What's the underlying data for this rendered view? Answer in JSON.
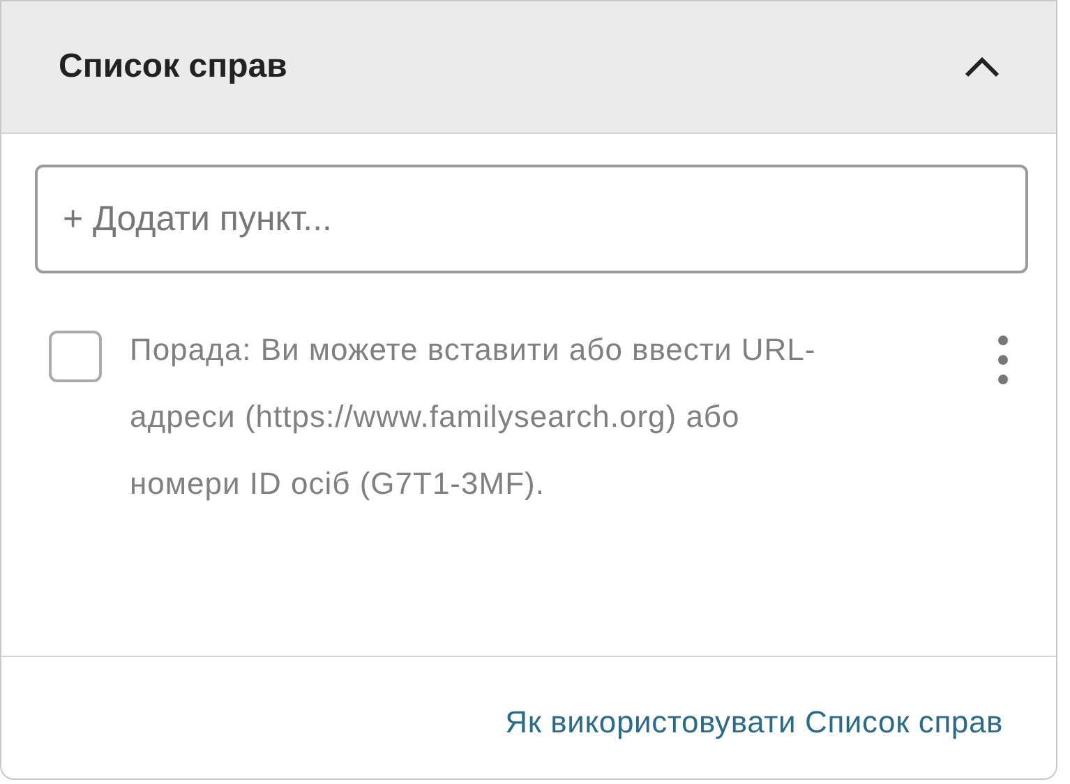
{
  "panel": {
    "title": "Список справ",
    "expanded": true
  },
  "add_field": {
    "placeholder": "+ Додати пункт..."
  },
  "items": [
    {
      "text": "Порада: Ви можете вставити або ввести URL-адреси (https://www.familysearch.org) або номери ID осіб (G7T1-3MF).",
      "checked": false
    }
  ],
  "footer_link": "Як використовувати Список справ"
}
